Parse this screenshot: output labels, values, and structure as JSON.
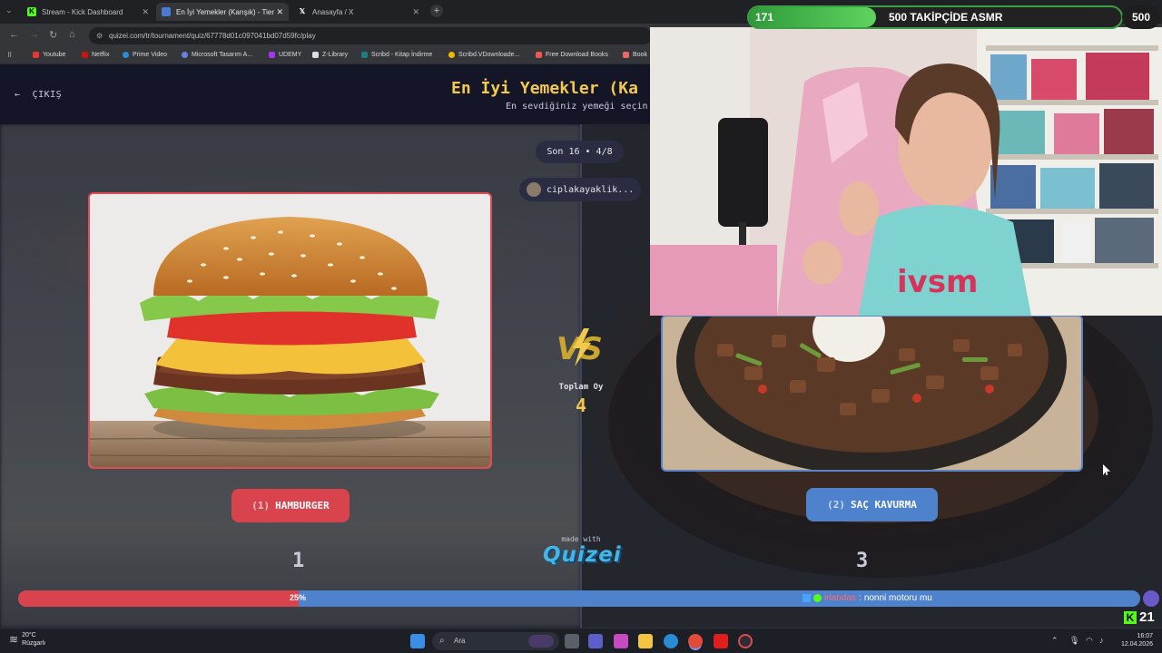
{
  "browser": {
    "tabs": [
      {
        "title": "Stream - Kick Dashboard",
        "active": false,
        "favicon": "kick-icon"
      },
      {
        "title": "En İyi Yemekler (Karışık) - Tier L",
        "active": true,
        "favicon": "quizei-icon"
      },
      {
        "title": "Anasayfa / X",
        "active": false,
        "favicon": "x-icon"
      }
    ],
    "url": "quizei.com/tr/tournament/quiz/67778d01c097041bd07d59fc/play",
    "bookmarks": [
      "Youtube",
      "Netflix",
      "Prime Video",
      "Microsoft Tasarım A...",
      "UDEMY",
      "Z-Library",
      "Scribd - Kitap İndirme",
      "Scribd.VDownloade...",
      "Free Download Books",
      "Book"
    ]
  },
  "quiz": {
    "exit_label": "ÇIKIŞ",
    "title": "En İyi Yemekler (Ka",
    "subtitle": "En sevdiğiniz yemeği seçin",
    "round_label": "Son 16 • 4/8",
    "creator": "ciplakayaklik...",
    "vs_label": "VS",
    "total_votes_label": "Toplam Oy",
    "total_votes": "4",
    "option_left": {
      "number": "(1)",
      "name": "HAMBURGER",
      "votes": "1",
      "image": "hamburger-photo"
    },
    "option_right": {
      "number": "(2)",
      "name": "SAÇ KAVURMA",
      "votes": "3",
      "image": "sac-kavurma-photo"
    },
    "vote_split_percent": 25,
    "vote_split_label": "25%",
    "made_with": "made with",
    "logo": "Quizei",
    "colors": {
      "left": "#d9434e",
      "right": "#4f82cc",
      "accent": "#f2c94c"
    }
  },
  "stream": {
    "follower_current": "171",
    "follower_goal_label": "500 TAKİPÇİDE ASMR",
    "follower_goal": "500",
    "follower_progress": 0.342,
    "chat_user": "irlandas",
    "chat_message": "nonni motoru mu",
    "viewer_count": "21"
  },
  "taskbar": {
    "weather_temp": "20°C",
    "weather_desc": "Rüzgarlı",
    "search_placeholder": "Ara",
    "time": "16:07",
    "date": "12.04.2026"
  }
}
